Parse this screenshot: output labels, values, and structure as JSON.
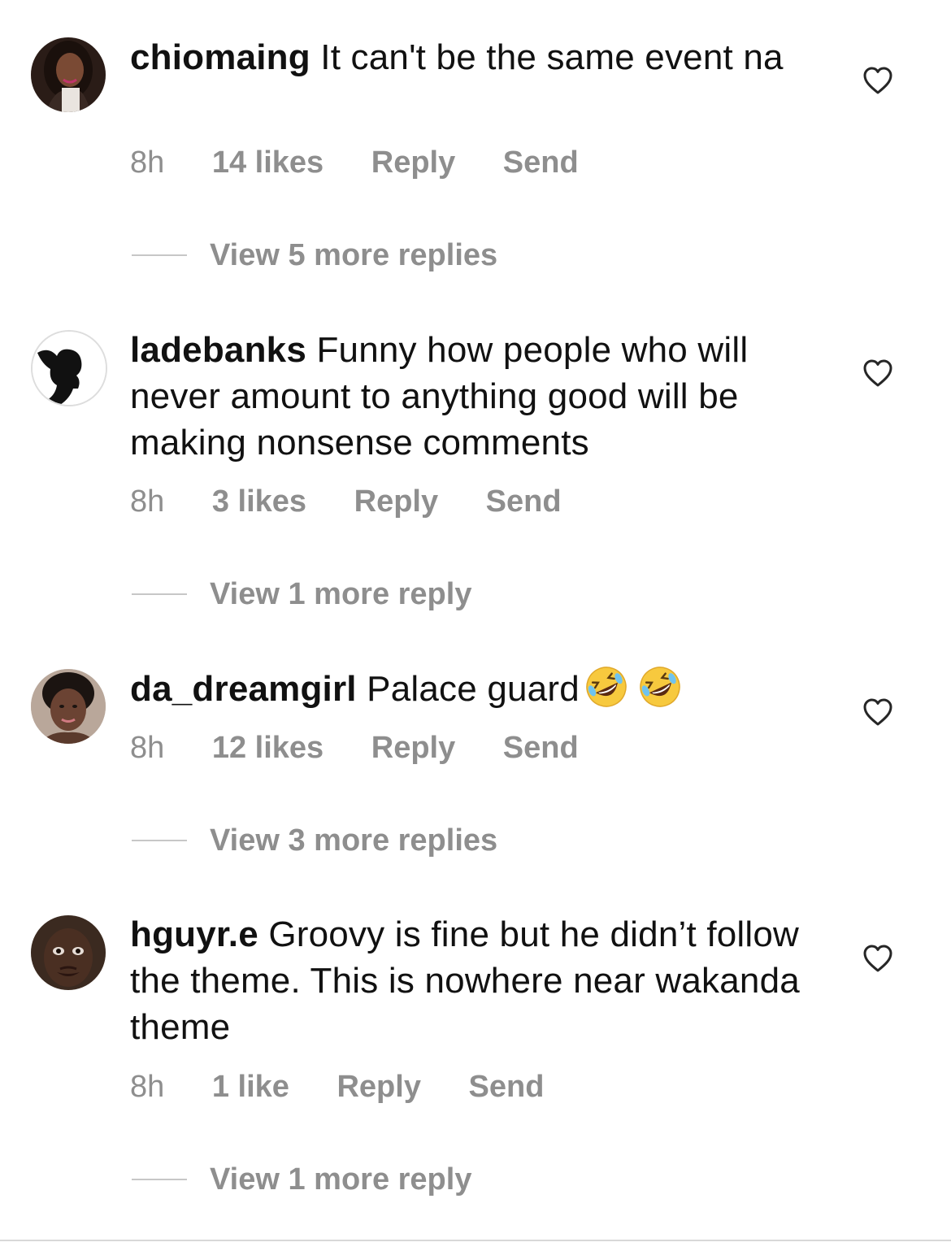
{
  "comments": [
    {
      "username": "chiomaing",
      "text": "It can't be the same event na",
      "time": "8h",
      "likes": "14 likes",
      "reply_label": "Reply",
      "send_label": "Send",
      "view_replies": "View 5 more replies",
      "avatar_icon": "profile-photo"
    },
    {
      "username": "ladebanks",
      "text": "Funny how people who will never amount to anything good will be making nonsense comments",
      "time": "8h",
      "likes": "3 likes",
      "reply_label": "Reply",
      "send_label": "Send",
      "view_replies": "View 1 more reply",
      "avatar_icon": "silhouette-logo"
    },
    {
      "username": "da_dreamgirl",
      "text": "Palace guard",
      "emoji": [
        "rolling-on-floor-laughing-emoji",
        "rolling-on-floor-laughing-emoji"
      ],
      "time": "8h",
      "likes": "12 likes",
      "reply_label": "Reply",
      "send_label": "Send",
      "view_replies": "View 3 more replies",
      "avatar_icon": "profile-photo"
    },
    {
      "username": "hguyr.e",
      "text": "Groovy is fine but he didn’t follow the theme. This is nowhere near wakanda theme",
      "time": "8h",
      "likes": "1 like",
      "reply_label": "Reply",
      "send_label": "Send",
      "view_replies": "View 1 more reply",
      "avatar_icon": "profile-photo"
    }
  ],
  "colors": {
    "text": "#111111",
    "meta": "#8e8e8e",
    "divider": "#c7c7c7"
  },
  "icons": {
    "like": "heart-outline-icon"
  }
}
